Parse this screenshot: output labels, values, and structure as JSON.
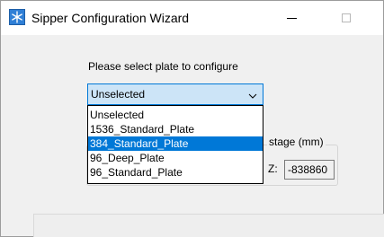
{
  "window": {
    "title": "Sipper Configuration Wizard",
    "icon": "snowflake-app-icon"
  },
  "prompt": "Please select plate to configure",
  "plate_select": {
    "selected": "Unselected",
    "options": [
      "Unselected",
      "1536_Standard_Plate",
      "384_Standard_Plate",
      "96_Deep_Plate",
      "96_Standard_Plate"
    ],
    "highlighted_option": "384_Standard_Plate"
  },
  "stage_group": {
    "title": "stage (mm)",
    "z_label": "Z:",
    "z_value": "-838860"
  },
  "colors": {
    "accent": "#0078d7",
    "combo_background": "#cce4f7",
    "window_background": "#f0f0f0"
  }
}
